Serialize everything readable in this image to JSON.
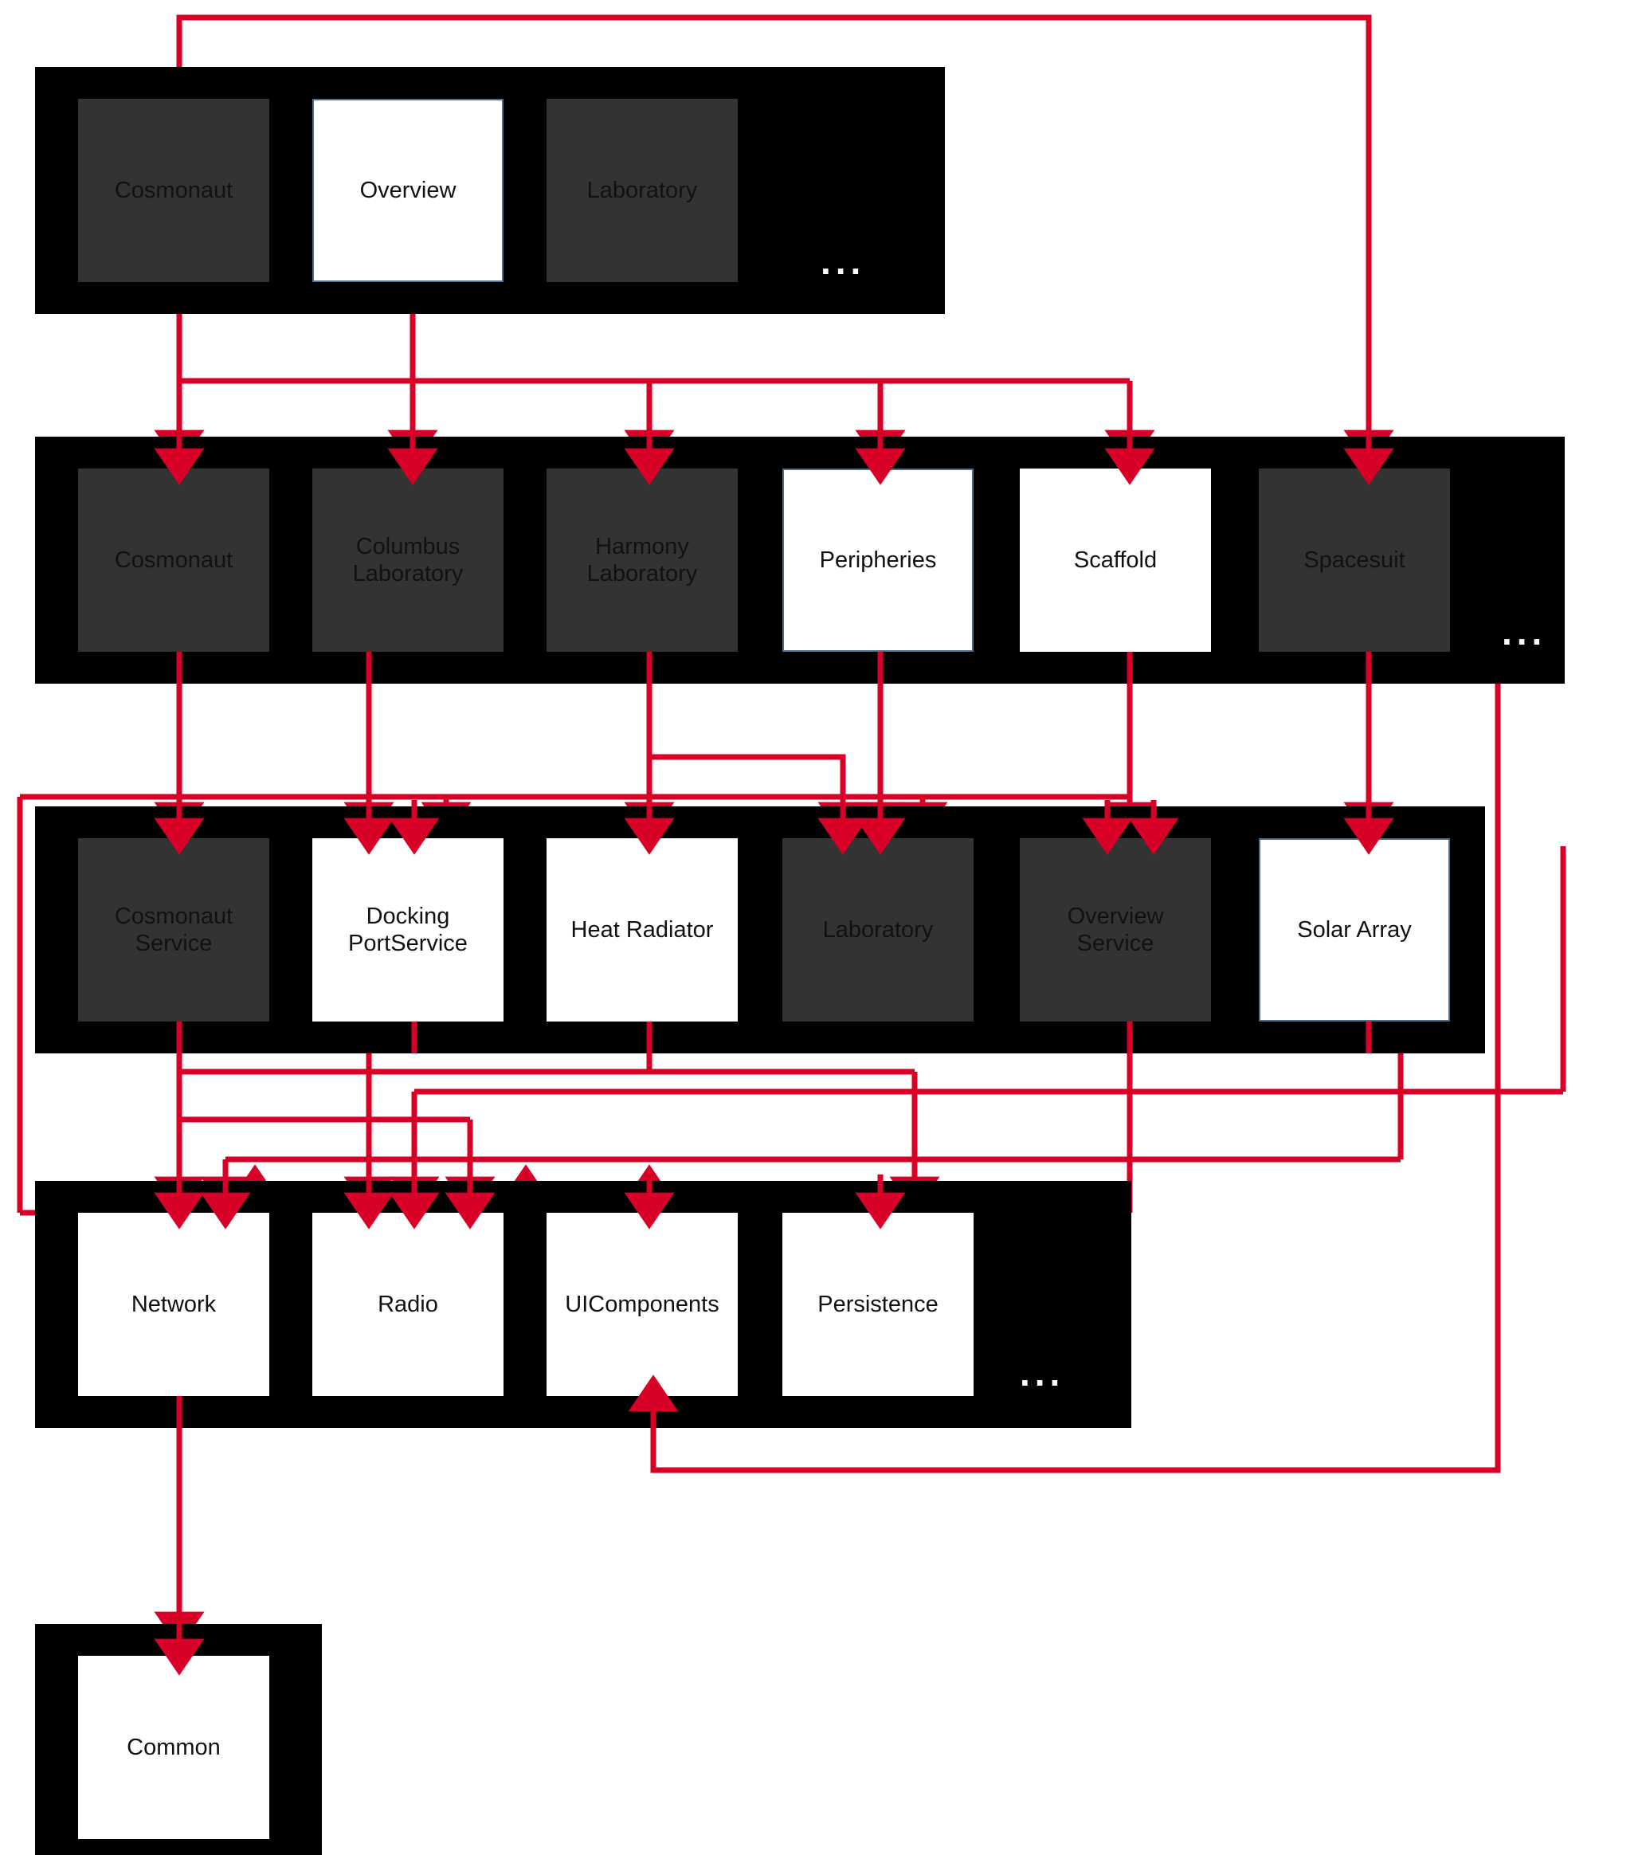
{
  "diagram": {
    "title": "Software architecture layer dependency diagram",
    "colors": {
      "arrow": "#d80027",
      "band": "#000000",
      "node_white": "#ffffff",
      "node_dark": "#333333",
      "node_border_blue": "#4a6f8a",
      "background": "#ffffff",
      "text": "#111111"
    },
    "ellipsis_label": "...",
    "layers": [
      {
        "id": "layer-applications",
        "nodes": [
          {
            "id": "cosmonaut-app",
            "label": "Cosmonaut",
            "style": "dark"
          },
          {
            "id": "overview-app",
            "label": "Overview",
            "style": "white-blue"
          },
          {
            "id": "laboratory-app",
            "label": "Laboratory",
            "style": "dark"
          }
        ],
        "has_ellipsis": true
      },
      {
        "id": "layer-features",
        "nodes": [
          {
            "id": "cosmonaut-feature",
            "label": "Cosmonaut",
            "style": "dark"
          },
          {
            "id": "columbus-laboratory-feature",
            "label": "Columbus\nLaboratory",
            "style": "dark"
          },
          {
            "id": "harmony-laboratory-feature",
            "label": "Harmony\nLaboratory",
            "style": "dark"
          },
          {
            "id": "peripheries-feature",
            "label": "Peripheries",
            "style": "white-blue"
          },
          {
            "id": "scaffold-feature",
            "label": "Scaffold",
            "style": "white"
          },
          {
            "id": "spacesuit-feature",
            "label": "Spacesuit",
            "style": "dark"
          }
        ],
        "has_ellipsis": true
      },
      {
        "id": "layer-services",
        "nodes": [
          {
            "id": "cosmonaut-service",
            "label": "Cosmonaut\nService",
            "style": "dark"
          },
          {
            "id": "docking-port-service",
            "label": "Docking\nPortService",
            "style": "white"
          },
          {
            "id": "heat-radiator",
            "label": "Heat Radiator",
            "style": "white"
          },
          {
            "id": "laboratory-service",
            "label": "Laboratory",
            "style": "dark"
          },
          {
            "id": "overview-service",
            "label": "Overview\nService",
            "style": "dark"
          },
          {
            "id": "solar-array",
            "label": "Solar Array",
            "style": "white-blue"
          }
        ],
        "has_ellipsis": true
      },
      {
        "id": "layer-libraries",
        "nodes": [
          {
            "id": "network",
            "label": "Network",
            "style": "white"
          },
          {
            "id": "radio",
            "label": "Radio",
            "style": "white"
          },
          {
            "id": "uicomponents",
            "label": "UIComponents",
            "style": "white"
          },
          {
            "id": "persistence",
            "label": "Persistence",
            "style": "white"
          }
        ],
        "has_ellipsis": true
      },
      {
        "id": "layer-common",
        "nodes": [
          {
            "id": "common",
            "label": "Common",
            "style": "white"
          }
        ],
        "has_ellipsis": false
      }
    ],
    "edges": [
      {
        "from": "cosmonaut-app",
        "to": "spacesuit-feature"
      },
      {
        "from": "cosmonaut-app",
        "to": "cosmonaut-feature"
      },
      {
        "from": "cosmonaut-app",
        "to": "peripheries-feature"
      },
      {
        "from": "cosmonaut-app",
        "to": "scaffold-feature"
      },
      {
        "from": "overview-app",
        "to": "columbus-laboratory-feature"
      },
      {
        "from": "overview-app",
        "to": "harmony-laboratory-feature"
      },
      {
        "from": "cosmonaut-feature",
        "to": "cosmonaut-service"
      },
      {
        "from": "columbus-laboratory-feature",
        "to": "docking-port-service"
      },
      {
        "from": "harmony-laboratory-feature",
        "to": "heat-radiator"
      },
      {
        "from": "harmony-laboratory-feature",
        "to": "laboratory-service"
      },
      {
        "from": "peripheries-feature",
        "to": "laboratory-service"
      },
      {
        "from": "scaffold-feature",
        "to": "overview-service"
      },
      {
        "from": "spacesuit-feature",
        "to": "solar-array"
      },
      {
        "from": "spacesuit-feature",
        "to": "uicomponents"
      },
      {
        "from": "cosmonaut-service",
        "to": "network"
      },
      {
        "from": "cosmonaut-service",
        "to": "radio"
      },
      {
        "from": "docking-port-service",
        "to": "network"
      },
      {
        "from": "docking-port-service",
        "to": "radio"
      },
      {
        "from": "heat-radiator",
        "to": "radio"
      },
      {
        "from": "heat-radiator",
        "to": "persistence"
      },
      {
        "from": "overview-service",
        "to": "radio"
      },
      {
        "from": "solar-array",
        "to": "network"
      },
      {
        "from": "network",
        "to": "common"
      }
    ]
  }
}
